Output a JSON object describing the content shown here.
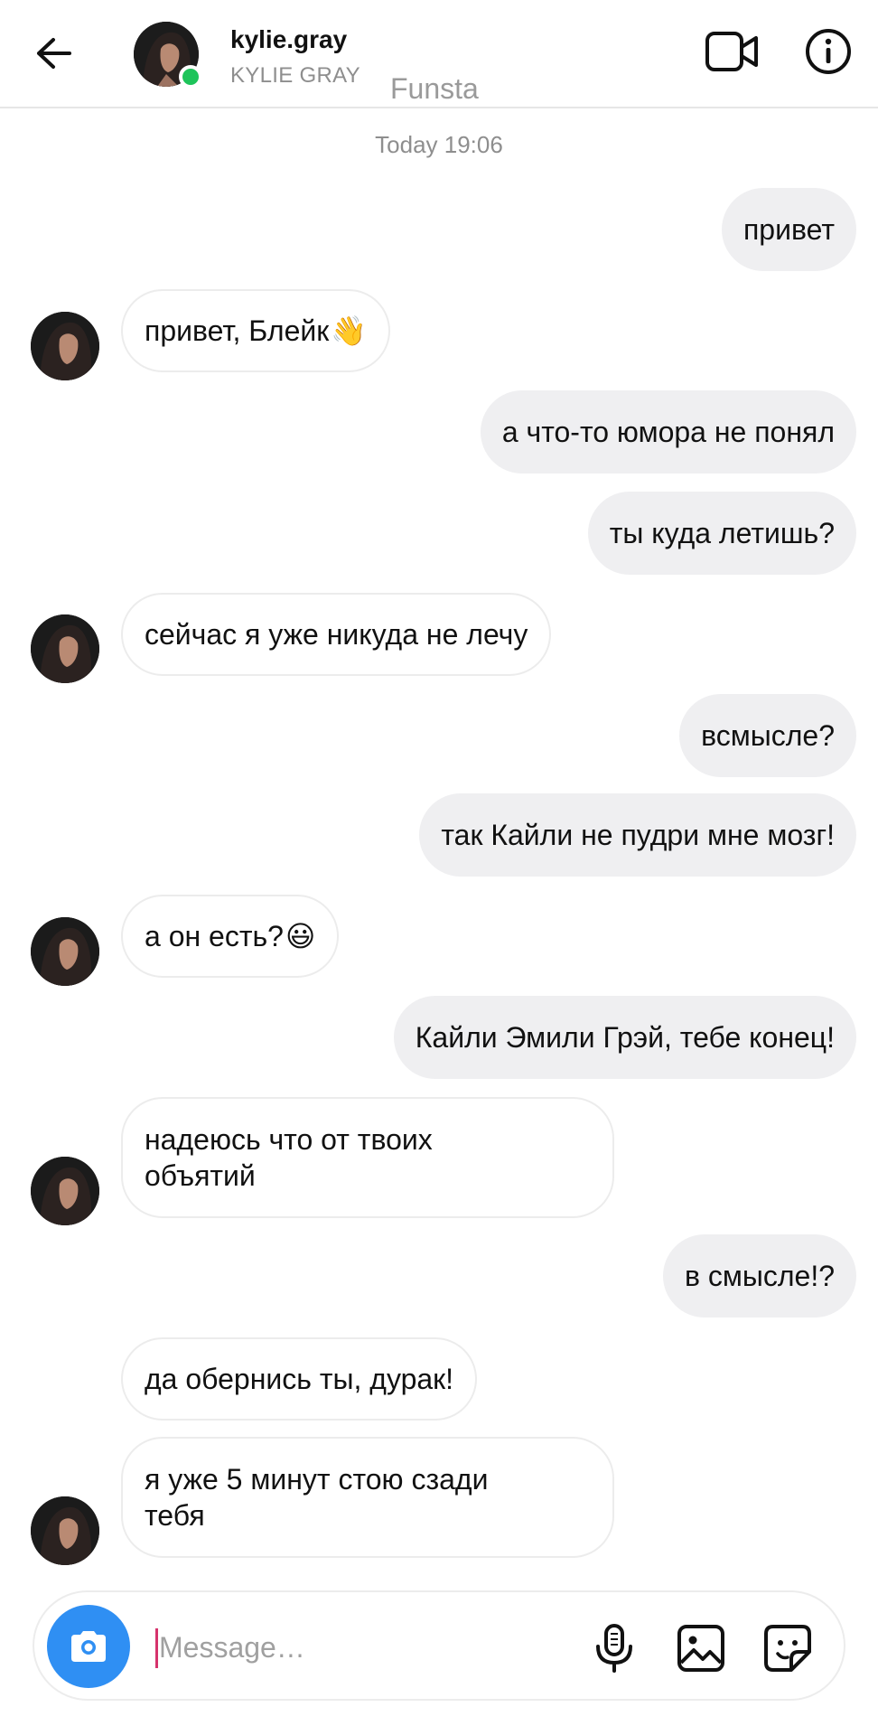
{
  "header": {
    "username": "kylie.gray",
    "full_name": "KYLIE GRAY",
    "overlay_label": "Funsta",
    "icons": {
      "back": "back-arrow-icon",
      "video": "video-call-icon",
      "info": "info-icon"
    },
    "online_color": "#1ec45a"
  },
  "chat": {
    "timestamp": "Today 19:06",
    "messages": [
      {
        "from": "me",
        "text": "привет"
      },
      {
        "from": "them",
        "text": "привет, Блейк",
        "emoji": "👋"
      },
      {
        "from": "me",
        "text": "а что-то юмора не понял"
      },
      {
        "from": "me",
        "text": "ты куда летишь?"
      },
      {
        "from": "them",
        "text": "сейчас я уже никуда не лечу"
      },
      {
        "from": "me",
        "text": "всмысле?"
      },
      {
        "from": "me",
        "text": "так Кайли не пудри мне мозг!"
      },
      {
        "from": "them",
        "text": "а он есть?",
        "emoji": "😃"
      },
      {
        "from": "me",
        "text": "Кайли Эмили Грэй, тебе конец!"
      },
      {
        "from": "them",
        "text": "надеюсь что от твоих объятий"
      },
      {
        "from": "me",
        "text": "в смысле!?"
      },
      {
        "from": "them",
        "text": "да обернись ты, дурак!"
      },
      {
        "from": "them",
        "text": "я уже 5 минут стою сзади тебя"
      }
    ]
  },
  "composer": {
    "placeholder": "Message…",
    "value": "",
    "icons": {
      "camera": "camera-icon",
      "mic": "microphone-icon",
      "gallery": "gallery-icon",
      "sticker": "sticker-icon"
    },
    "accent_color": "#2f8ff3"
  },
  "colors": {
    "sent_bubble": "#efeff1",
    "received_border": "#ececec",
    "muted_text": "#8e8e8e"
  }
}
